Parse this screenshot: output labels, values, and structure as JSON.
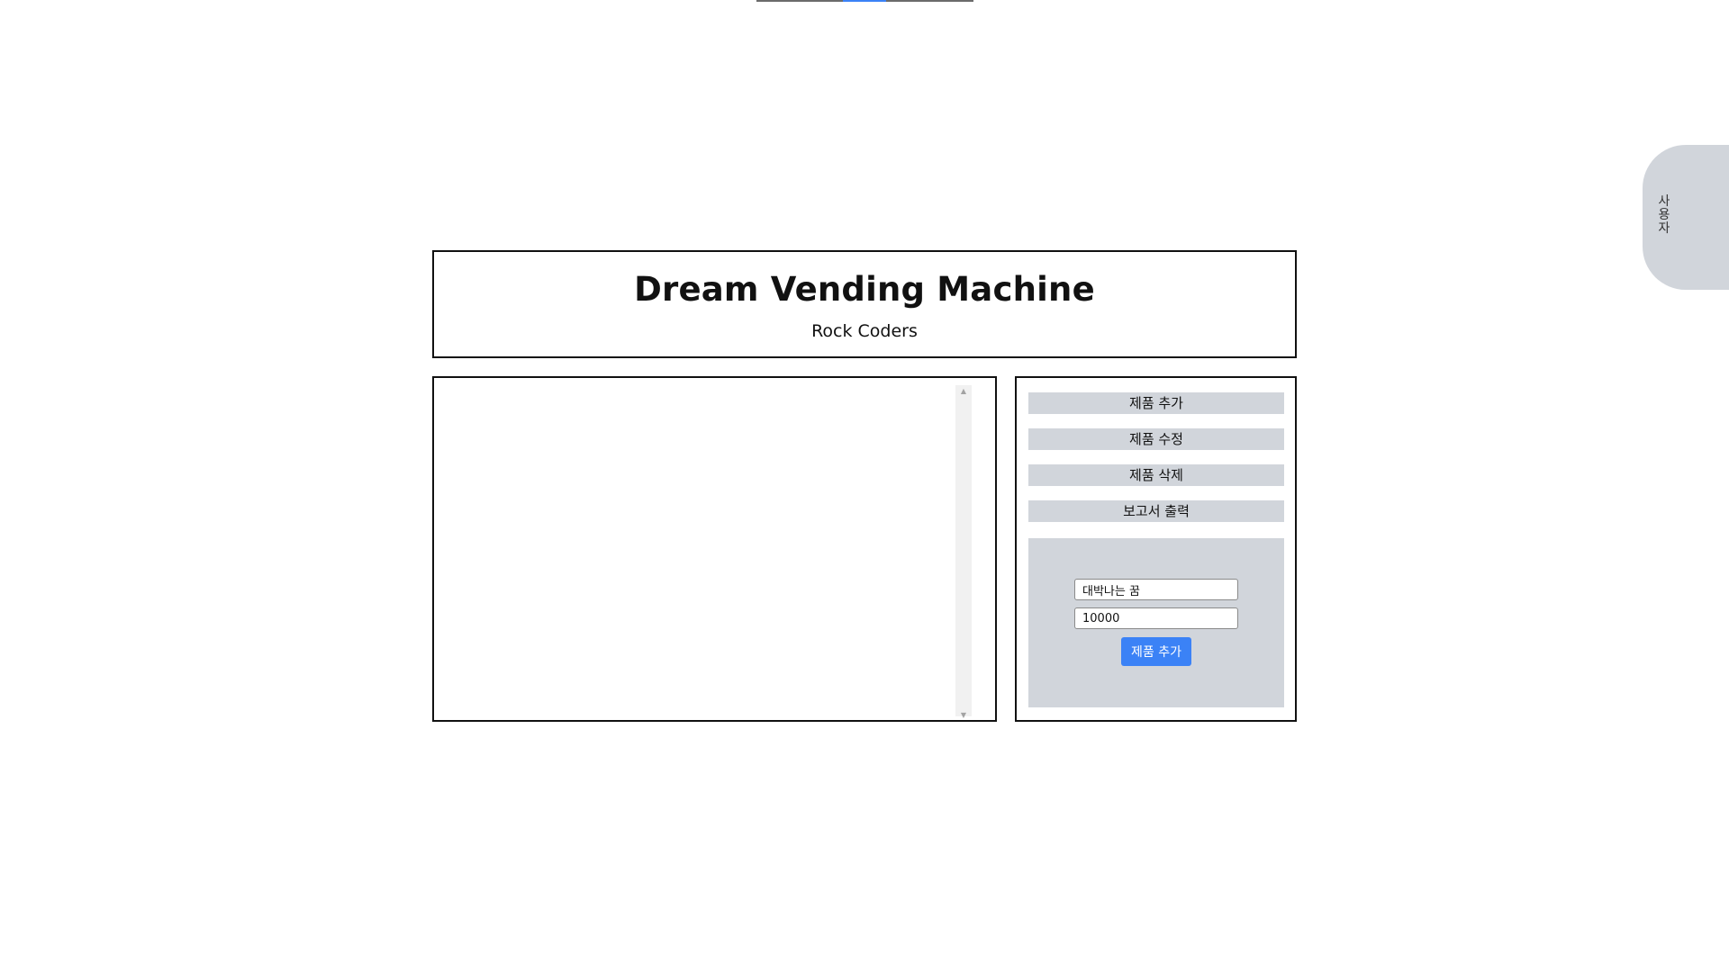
{
  "app": {
    "title": "Dream Vending Machine",
    "subtitle": "Rock Coders"
  },
  "side_tab": {
    "label": "사용자"
  },
  "admin_menu": {
    "items": [
      {
        "label": "제품 추가"
      },
      {
        "label": "제품 수정"
      },
      {
        "label": "제품 삭제"
      },
      {
        "label": "보고서 출력"
      }
    ]
  },
  "product_form": {
    "name_value": "대박나는 꿈",
    "price_value": "10000",
    "submit_label": "제품 추가"
  },
  "icons": {
    "scroll_up": "triangle-up",
    "scroll_down": "triangle-down"
  },
  "colors": {
    "accent": "#3b82f6",
    "panel_gray": "#d1d5db"
  }
}
